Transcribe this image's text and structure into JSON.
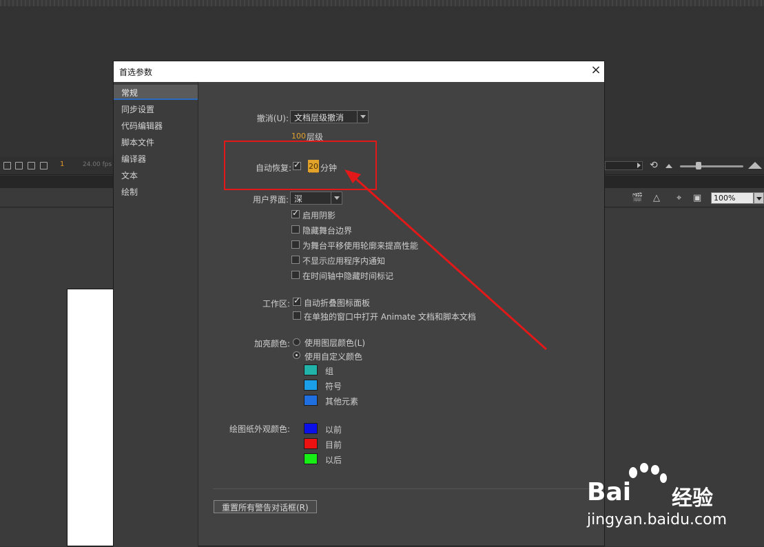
{
  "timeline": {
    "frame": "1",
    "fps": "24.00 fps"
  },
  "stage": {
    "zoom": "100%"
  },
  "dialog": {
    "title": "首选参数",
    "close_glyph": "×",
    "sidebar": [
      "常规",
      "同步设置",
      "代码编辑器",
      "脚本文件",
      "编译器",
      "文本",
      "绘制"
    ],
    "undo": {
      "label": "撤消(U):",
      "value": "文档层级撤消",
      "levels": "100",
      "levels_unit": "层级"
    },
    "autorecover": {
      "label": "自动恢复:",
      "checked": true,
      "minutes": "20",
      "unit": "分钟"
    },
    "ui": {
      "label": "用户界面:",
      "theme": "深",
      "options": [
        {
          "text": "启用阴影",
          "checked": true
        },
        {
          "text": "隐藏舞台边界",
          "checked": false
        },
        {
          "text": "为舞台平移使用轮廓来提高性能",
          "checked": false
        },
        {
          "text": "不显示应用程序内通知",
          "checked": false
        },
        {
          "text": "在时间轴中隐藏时间标记",
          "checked": false
        }
      ]
    },
    "workspace": {
      "label": "工作区:",
      "options": [
        {
          "text": "自动折叠图标面板",
          "checked": true
        },
        {
          "text": "在单独的窗口中打开 Animate 文档和脚本文档",
          "checked": false
        }
      ]
    },
    "highlight": {
      "label": "加亮颜色:",
      "radio1": "使用图层颜色(L)",
      "radio2": "使用自定义颜色",
      "selected": "使用自定义颜色",
      "swatches": [
        {
          "label": "组",
          "color": "#21b3a9"
        },
        {
          "label": "符号",
          "color": "#1a9fe8"
        },
        {
          "label": "其他元素",
          "color": "#1f6fe0"
        }
      ]
    },
    "onion": {
      "label": "绘图纸外观颜色:",
      "swatches": [
        {
          "label": "以前",
          "color": "#0b10e8"
        },
        {
          "label": "目前",
          "color": "#ee1111"
        },
        {
          "label": "以后",
          "color": "#16ee16"
        }
      ]
    },
    "reset_button": "重置所有警告对话框(R)"
  },
  "watermark": {
    "brand": "Bai",
    "brand_cn": "经验",
    "url": "jingyan.baidu.com"
  },
  "annotation_color": "#e31818"
}
